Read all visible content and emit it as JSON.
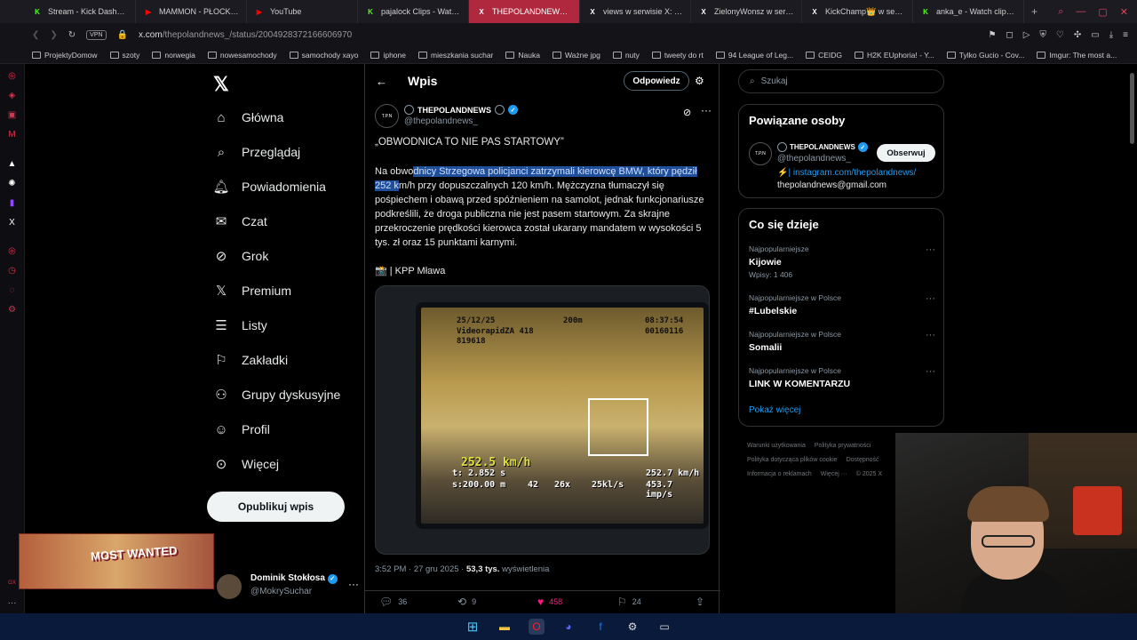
{
  "tabs": [
    {
      "title": "Stream - Kick Dashboard",
      "icon": "K",
      "color": "#53fc18"
    },
    {
      "title": "MAMMON - PŁOCKIE KO",
      "icon": "▶",
      "color": "#ff0000"
    },
    {
      "title": "YouTube",
      "icon": "▶",
      "color": "#ff0000"
    },
    {
      "title": "pajalock Clips - Watch L",
      "icon": "K",
      "color": "#53fc18"
    },
    {
      "title": "THEPOLANDNEWS 🌐 w s",
      "icon": "X",
      "color": "#ffffff"
    },
    {
      "title": "views w serwisie X: „Miz",
      "icon": "X",
      "color": "#ffffff"
    },
    {
      "title": "ZielonyWonsz w serwisi",
      "icon": "X",
      "color": "#ffffff"
    },
    {
      "title": "KickChamp👑 w serwis",
      "icon": "X",
      "color": "#ffffff"
    },
    {
      "title": "anka_e - Watch clips on",
      "icon": "K",
      "color": "#53fc18"
    }
  ],
  "address": {
    "vpn": "VPN",
    "url_host": "x.com",
    "url_path": "/thepolandnews_/status/2004928372166606970"
  },
  "bookmarks": [
    "ProjektyDomow",
    "szoty",
    "norwegia",
    "nowesamochody",
    "samochody xayo",
    "iphone",
    "mieszkania suchar",
    "Nauka",
    "Ważne jpg",
    "nuty",
    "tweety do rt",
    "94 League of Leg...",
    "CEIDG",
    "H2K EUphoria! - Y...",
    "Tylko Gucio - Cov...",
    "Imgur: The most a..."
  ],
  "nav": {
    "home": "Główna",
    "explore": "Przeglądaj",
    "notifications": "Powiadomienia",
    "chat": "Czat",
    "grok": "Grok",
    "premium": "Premium",
    "lists": "Listy",
    "bookmarks": "Zakładki",
    "communities": "Grupy dyskusyjne",
    "profile": "Profil",
    "more": "Więcej",
    "post_button": "Opublikuj wpis"
  },
  "account": {
    "name": "Dominik Stokłosa",
    "handle": "@MokrySuchar"
  },
  "stream_overlay": {
    "text": "MOST WANTED"
  },
  "post_header": {
    "title": "Wpis",
    "reply_button": "Odpowiedz"
  },
  "tweet": {
    "author_name": "THEPOLANDNEWS",
    "author_handle": "@thepolandnews_",
    "avatar_text": "T.P.N",
    "headline": "„OBWODNICA TO NIE PAS STARTOWY”",
    "body_pre": "Na obwo",
    "body_highlight": "dnicy Strzegowa policjanci zatrzymali kierowcę BMW, który pędził 252 k",
    "body_post": "m/h przy dopuszczalnych 120 km/h. Mężczyzna tłumaczył się pośpiechem i obawą przed spóźnieniem na samolot, jednak funkcjonariusze podkreślili, że droga publiczna nie jest pasem startowym. Za skrajne przekroczenie prędkości kierowca został ukarany mandatem w wysokości 5 tys. zł oraz 15 punktami karnymi.",
    "source": "📸 | KPP Mława",
    "time": "3:52 PM · 27 gru 2025 ·",
    "views": "53,3 tys.",
    "views_label": "wyświetlenia",
    "replies": "36",
    "reposts": "9",
    "likes": "458",
    "bookmarks": "24"
  },
  "photo_osd": {
    "date": "25/12/25",
    "dist": "200m",
    "time": "08:37:54",
    "device": "VideorapidZA 418",
    "serial": "819618",
    "counter": "00160116",
    "speed": "252.5 km/h",
    "t": "t: 2.852 s",
    "s": "s:200.00 m",
    "angle": "42",
    "zoom": "26x",
    "rate": "25kl/s",
    "speed2": "252.7 km/h",
    "imp": "453.7 imp/s"
  },
  "search": {
    "placeholder": "Szukaj"
  },
  "related": {
    "title": "Powiązane osoby",
    "name": "THEPOLANDNEWS",
    "handle": "@thepolandnews_",
    "follow": "Obserwuj",
    "bio_link": "instagram.com/thepolandnews/",
    "bio_email": "thepolandnews@gmail.com"
  },
  "trending": {
    "title": "Co się dzieje",
    "items": [
      {
        "category": "Najpopularniejsze",
        "topic": "Kijowie",
        "count": "Wpisy: 1 406"
      },
      {
        "category": "Najpopularniejsze w Polsce",
        "topic": "#Lubelskie",
        "count": ""
      },
      {
        "category": "Najpopularniejsze w Polsce",
        "topic": "Somalii",
        "count": ""
      },
      {
        "category": "Najpopularniejsze w Polsce",
        "topic": "LINK W KOMENTARZU",
        "count": ""
      }
    ],
    "show_more": "Pokaż więcej"
  },
  "footer": [
    "Warunki użytkowania",
    "Polityka prywatności",
    "Polityka dotycząca plików cookie",
    "Dostępność",
    "Informacja o reklamach",
    "Więcej ···",
    "© 2025 X"
  ]
}
